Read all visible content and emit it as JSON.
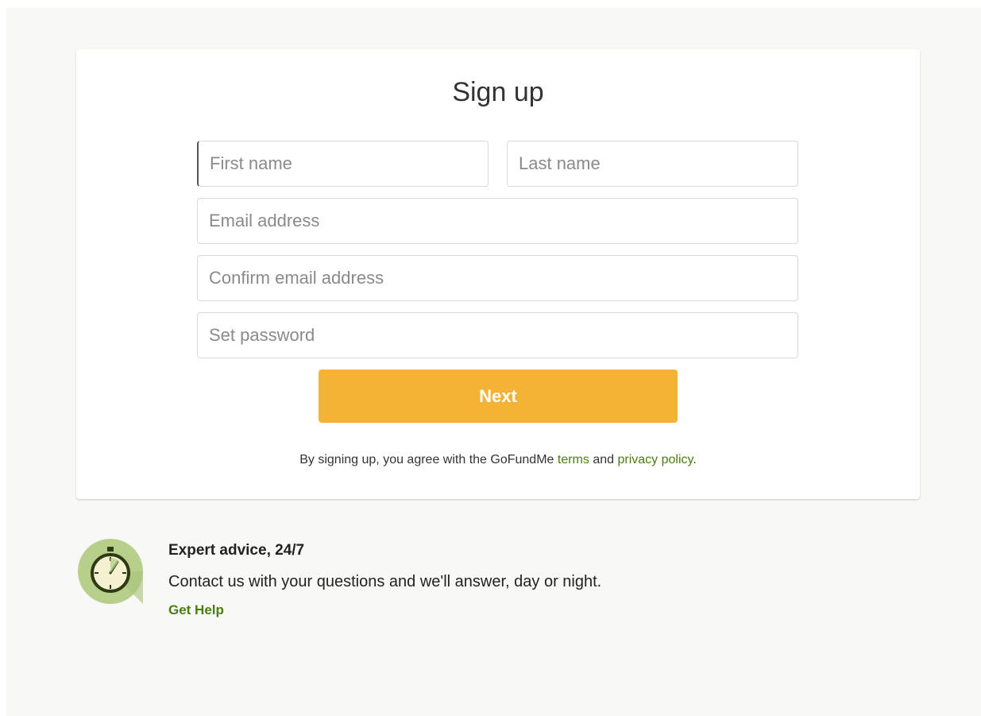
{
  "signup": {
    "title": "Sign up",
    "first_name_placeholder": "First name",
    "last_name_placeholder": "Last name",
    "email_placeholder": "Email address",
    "confirm_email_placeholder": "Confirm email address",
    "password_placeholder": "Set password",
    "next_label": "Next",
    "terms_prefix": "By signing up, you agree with the GoFundMe ",
    "terms_link": "terms",
    "terms_and": " and ",
    "privacy_link": "privacy policy",
    "terms_suffix": "."
  },
  "help": {
    "icon": "stopwatch-icon",
    "title": "Expert advice, 24/7",
    "text": "Contact us with your questions and we'll answer, day or night.",
    "link": "Get Help"
  },
  "colors": {
    "accent_button": "#f5b335",
    "link_green": "#4b7d12",
    "background": "#f8f8f6"
  }
}
